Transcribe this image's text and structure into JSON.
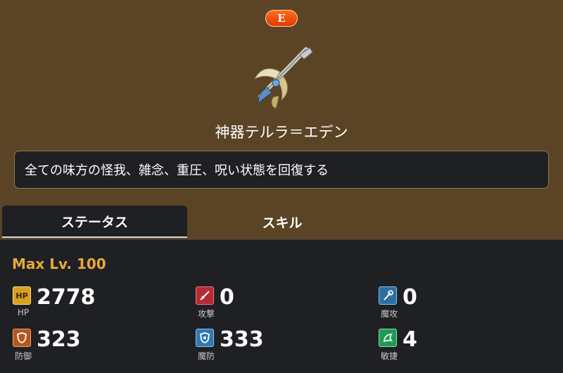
{
  "item": {
    "rarity": "E",
    "name": "神器テルラ＝エデン",
    "description": "全ての味方の怪我、雑念、重圧、呪い状態を回復する"
  },
  "tabs": [
    {
      "label": "ステータス",
      "active": true
    },
    {
      "label": "スキル",
      "active": false
    }
  ],
  "stats": {
    "max_level": "Max Lv. 100",
    "items": [
      {
        "icon": "hp-icon",
        "icon_text": "HP",
        "label": "HP",
        "value": "2778",
        "color": "#c98a12"
      },
      {
        "icon": "attack-icon",
        "label": "攻撃",
        "value": "0",
        "color": "#b52a35"
      },
      {
        "icon": "magic-attack-icon",
        "label": "魔攻",
        "value": "0",
        "color": "#2d6fa3"
      },
      {
        "icon": "defense-icon",
        "label": "防御",
        "value": "323",
        "color": "#b5561c"
      },
      {
        "icon": "magic-defense-icon",
        "label": "魔防",
        "value": "333",
        "color": "#2f79b3"
      },
      {
        "icon": "agility-icon",
        "label": "敏捷",
        "value": "4",
        "color": "#1f9a55"
      }
    ]
  }
}
